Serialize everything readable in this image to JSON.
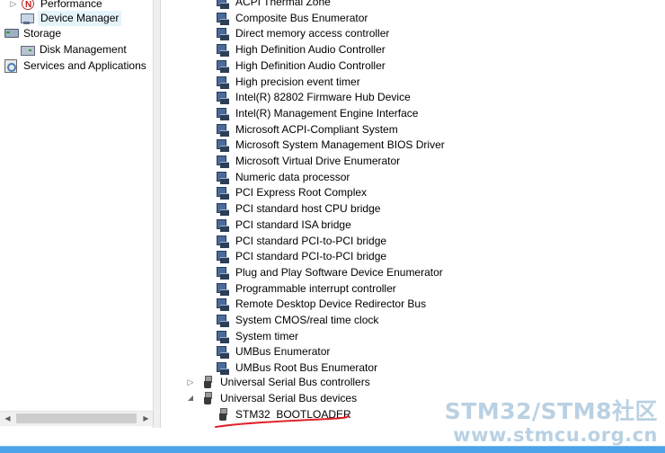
{
  "left_tree": {
    "performance": "Performance",
    "device_manager": "Device Manager",
    "storage": "Storage",
    "disk_management": "Disk Management",
    "services": "Services and Applications"
  },
  "devices": [
    "ACPI Thermal Zone",
    "Composite Bus Enumerator",
    "Direct memory access controller",
    "High Definition Audio Controller",
    "High Definition Audio Controller",
    "High precision event timer",
    "Intel(R) 82802 Firmware Hub Device",
    "Intel(R) Management Engine Interface",
    "Microsoft ACPI-Compliant System",
    "Microsoft System Management BIOS Driver",
    "Microsoft Virtual Drive Enumerator",
    "Numeric data processor",
    "PCI Express Root Complex",
    "PCI standard host CPU bridge",
    "PCI standard ISA bridge",
    "PCI standard PCI-to-PCI bridge",
    "PCI standard PCI-to-PCI bridge",
    "Plug and Play Software Device Enumerator",
    "Programmable interrupt controller",
    "Remote Desktop Device Redirector Bus",
    "System CMOS/real time clock",
    "System timer",
    "UMBus Enumerator",
    "UMBus Root Bus Enumerator"
  ],
  "categories": {
    "usb_controllers": "Universal Serial Bus controllers",
    "usb_devices": "Universal Serial Bus devices",
    "stm32": "STM32  BOOTLOADER"
  },
  "watermark": {
    "line1": "STM32/STM8社区",
    "line2": "www.stmcu.org.cn"
  },
  "icons": {
    "device": "system-device-icon",
    "usb": "usb-icon",
    "warning": "warning-overlay-icon"
  },
  "colors": {
    "selection": "#e5f3fb",
    "underline": "#e0202a",
    "taskbar": "#4aa2e8",
    "watermark": "#b2cde0"
  }
}
